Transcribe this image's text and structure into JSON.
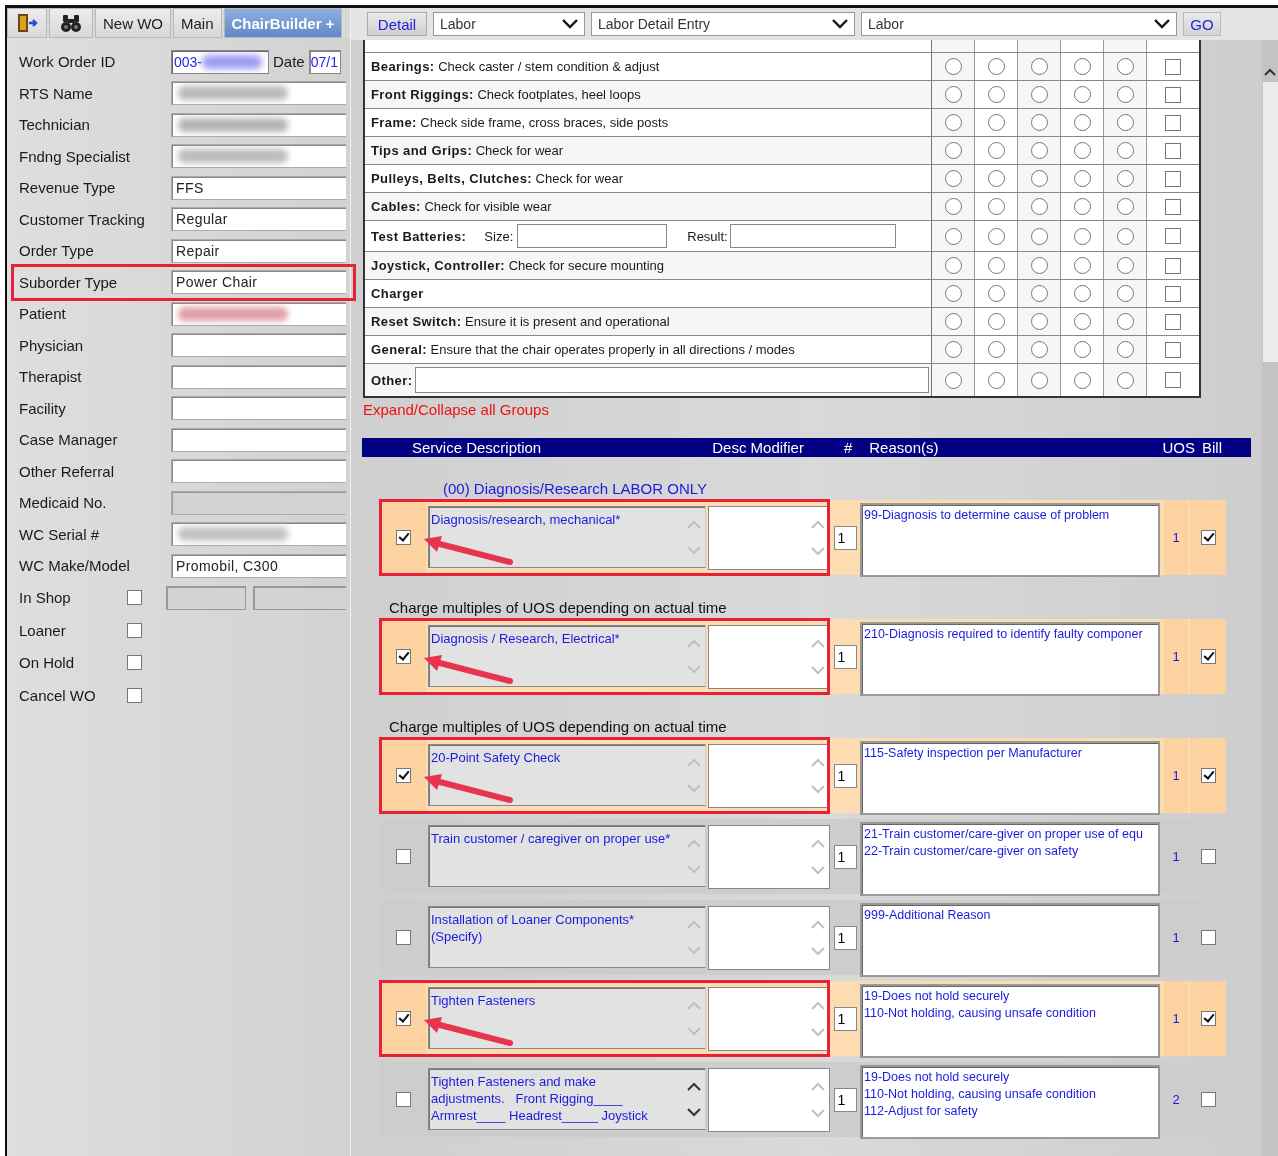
{
  "tabs": [
    {
      "kind": "exit",
      "selected": false
    },
    {
      "kind": "search",
      "selected": false
    },
    {
      "kind": "text",
      "label": "New WO",
      "selected": false
    },
    {
      "kind": "text",
      "label": "Main",
      "selected": false
    },
    {
      "kind": "text",
      "label": "ChairBuilder +",
      "selected": true
    }
  ],
  "form": [
    {
      "kind": "id_date",
      "label": "Work Order ID",
      "value": "003-",
      "color": "#9d9df2",
      "date_label": "Date",
      "date_value": "07/1"
    },
    {
      "kind": "field",
      "label": "RTS Name",
      "color": "#b9b9b9"
    },
    {
      "kind": "field",
      "label": "Technician",
      "color": "#b4b4b4"
    },
    {
      "kind": "field",
      "label": "Fndng Specialist",
      "color": "#bbbbbb"
    },
    {
      "kind": "field",
      "label": "Revenue Type",
      "value": "FFS"
    },
    {
      "kind": "field",
      "label": "Customer Tracking",
      "value": "Regular"
    },
    {
      "kind": "field",
      "label": "Order Type",
      "value": "Repair"
    },
    {
      "kind": "field",
      "label": "Suborder Type",
      "value": "Power Chair",
      "highlighted": true
    },
    {
      "kind": "field",
      "label": "Patient",
      "color": "#e0a0a6"
    },
    {
      "kind": "field",
      "label": "Physician"
    },
    {
      "kind": "field",
      "label": "Therapist"
    },
    {
      "kind": "field",
      "label": "Facility"
    },
    {
      "kind": "field",
      "label": "Case Manager"
    },
    {
      "kind": "field",
      "label": "Other Referral"
    },
    {
      "kind": "field",
      "label": "Medicaid No.",
      "disabled": true
    },
    {
      "kind": "field",
      "label": "WC Serial #",
      "color": "#c2c2c2"
    },
    {
      "kind": "field",
      "label": "WC Make/Model",
      "value": "Promobil, C300"
    },
    {
      "kind": "checkbox_fields",
      "label": "In Shop",
      "checked": false
    },
    {
      "kind": "checkbox",
      "label": "Loaner",
      "checked": false
    },
    {
      "kind": "checkbox",
      "label": "On Hold",
      "checked": false
    },
    {
      "kind": "checkbox",
      "label": "Cancel WO",
      "checked": false
    }
  ],
  "toolbar": {
    "detail_button": "Detail",
    "selects": [
      "Labor",
      "Labor Detail Entry",
      "Labor"
    ],
    "go_button": "GO"
  },
  "checklist": [
    {
      "kind": "text",
      "text": "**Bearings:** Check caster / stem condition & adjust",
      "choices": [
        {
          "selected": false
        },
        {
          "selected": false
        },
        {
          "selected": false
        },
        {
          "selected": false
        },
        {
          "selected": false
        }
      ],
      "checked": false
    },
    {
      "kind": "text",
      "text": "**Front Riggings:** Check footplates, heel loops",
      "choices": [
        {
          "selected": false
        },
        {
          "selected": false
        },
        {
          "selected": false
        },
        {
          "selected": false
        },
        {
          "selected": false
        }
      ],
      "checked": false
    },
    {
      "kind": "text",
      "text": "**Frame:** Check side frame, cross braces, side posts",
      "choices": [
        {
          "selected": false
        },
        {
          "selected": false
        },
        {
          "selected": false
        },
        {
          "selected": false
        },
        {
          "selected": false
        }
      ],
      "checked": false
    },
    {
      "kind": "text",
      "text": "**Tips and Grips:** Check for wear",
      "choices": [
        {
          "selected": false
        },
        {
          "selected": false
        },
        {
          "selected": false
        },
        {
          "selected": false
        },
        {
          "selected": false
        }
      ],
      "checked": false
    },
    {
      "kind": "text",
      "text": "**Pulleys, Belts, Clutches:** Check for wear",
      "choices": [
        {
          "selected": false
        },
        {
          "selected": false
        },
        {
          "selected": false
        },
        {
          "selected": false
        },
        {
          "selected": false
        }
      ],
      "checked": false
    },
    {
      "kind": "text",
      "text": "**Cables:** Check for visible wear",
      "choices": [
        {
          "selected": false
        },
        {
          "selected": false
        },
        {
          "selected": false
        },
        {
          "selected": false
        },
        {
          "selected": false
        }
      ],
      "checked": false
    },
    {
      "kind": "batteries",
      "title": "Test Batteries:",
      "size_label": "Size:",
      "result_label": "Result:",
      "choices": [
        {
          "selected": false
        },
        {
          "selected": false
        },
        {
          "selected": false
        },
        {
          "selected": false
        },
        {
          "selected": false
        }
      ],
      "checked": false
    },
    {
      "kind": "text",
      "text": "**Joystick, Controller:** Check for secure mounting",
      "choices": [
        {
          "selected": false
        },
        {
          "selected": false
        },
        {
          "selected": false
        },
        {
          "selected": false
        },
        {
          "selected": false
        }
      ],
      "checked": false
    },
    {
      "kind": "heading",
      "title": "Charger",
      "choices": [
        {
          "selected": false
        },
        {
          "selected": false
        },
        {
          "selected": false
        },
        {
          "selected": false
        },
        {
          "selected": false
        }
      ],
      "checked": false
    },
    {
      "kind": "text",
      "text": "**Reset Switch:** Ensure it is present and operational",
      "choices": [
        {
          "selected": false
        },
        {
          "selected": false
        },
        {
          "selected": false
        },
        {
          "selected": false
        },
        {
          "selected": false
        }
      ],
      "checked": false
    },
    {
      "kind": "text",
      "text": "**General:** Ensure that the chair operates properly in all directions / modes",
      "choices": [
        {
          "selected": false
        },
        {
          "selected": false
        },
        {
          "selected": false
        },
        {
          "selected": false
        },
        {
          "selected": false
        }
      ],
      "checked": false
    },
    {
      "kind": "other",
      "title": "Other:",
      "choices": [
        {
          "selected": false
        },
        {
          "selected": false
        },
        {
          "selected": false
        },
        {
          "selected": false
        },
        {
          "selected": false
        }
      ],
      "checked": false
    }
  ],
  "expand_link": "Expand/Collapse all Groups",
  "service_header": [
    "Service Description",
    "Desc Modifier",
    "#",
    "Reason(s)",
    "UOS",
    "Bill"
  ],
  "services": [
    {
      "kind": "group",
      "text": "(00) Diagnosis/Research LABOR ONLY"
    },
    {
      "kind": "service",
      "checked": true,
      "highlighted": true,
      "description": "Diagnosis/research, mechanical*",
      "count": "1",
      "reasons": [
        "99-Diagnosis to determine cause of problem"
      ],
      "uos": "1",
      "bill": true
    },
    {
      "kind": "note",
      "text": "Charge multiples of UOS depending on actual time"
    },
    {
      "kind": "service",
      "checked": true,
      "highlighted": true,
      "description": "Diagnosis / Research, Electrical*",
      "count": "1",
      "reasons": [
        "210-Diagnosis required to identify faulty componer"
      ],
      "uos": "1",
      "bill": true
    },
    {
      "kind": "note",
      "text": "Charge multiples of UOS depending on actual time"
    },
    {
      "kind": "service",
      "checked": true,
      "highlighted": true,
      "description": "20-Point Safety Check",
      "count": "1",
      "reasons": [
        "115-Safety inspection per Manufacturer"
      ],
      "uos": "1",
      "bill": true
    },
    {
      "kind": "service",
      "checked": false,
      "highlighted": false,
      "description": "Train customer / caregiver on proper use*",
      "count": "1",
      "reasons": [
        "21-Train customer/care-giver on proper use of equ",
        "22-Train customer/care-giver on safety"
      ],
      "uos": "1",
      "bill": false
    },
    {
      "kind": "service",
      "checked": false,
      "highlighted": false,
      "description": "Installation of Loaner Components*\n(Specify)",
      "count": "1",
      "reasons": [
        "999-Additional Reason"
      ],
      "uos": "1",
      "bill": false
    },
    {
      "kind": "service",
      "checked": true,
      "highlighted": true,
      "description": "Tighten Fasteners",
      "count": "1",
      "reasons": [
        "19-Does not hold securely",
        "110-Not holding, causing unsafe condition"
      ],
      "uos": "1",
      "bill": true
    },
    {
      "kind": "service",
      "checked": false,
      "highlighted": false,
      "scroll_active": true,
      "description": "Tighten Fasteners and make\nadjustments.   Front Rigging____\nArmrest____ Headrest_____ Joystick",
      "count": "1",
      "reasons": [
        "19-Does not hold securely",
        "110-Not holding, causing unsafe condition",
        "112-Adjust for safety"
      ],
      "uos": "2",
      "bill": false
    }
  ]
}
